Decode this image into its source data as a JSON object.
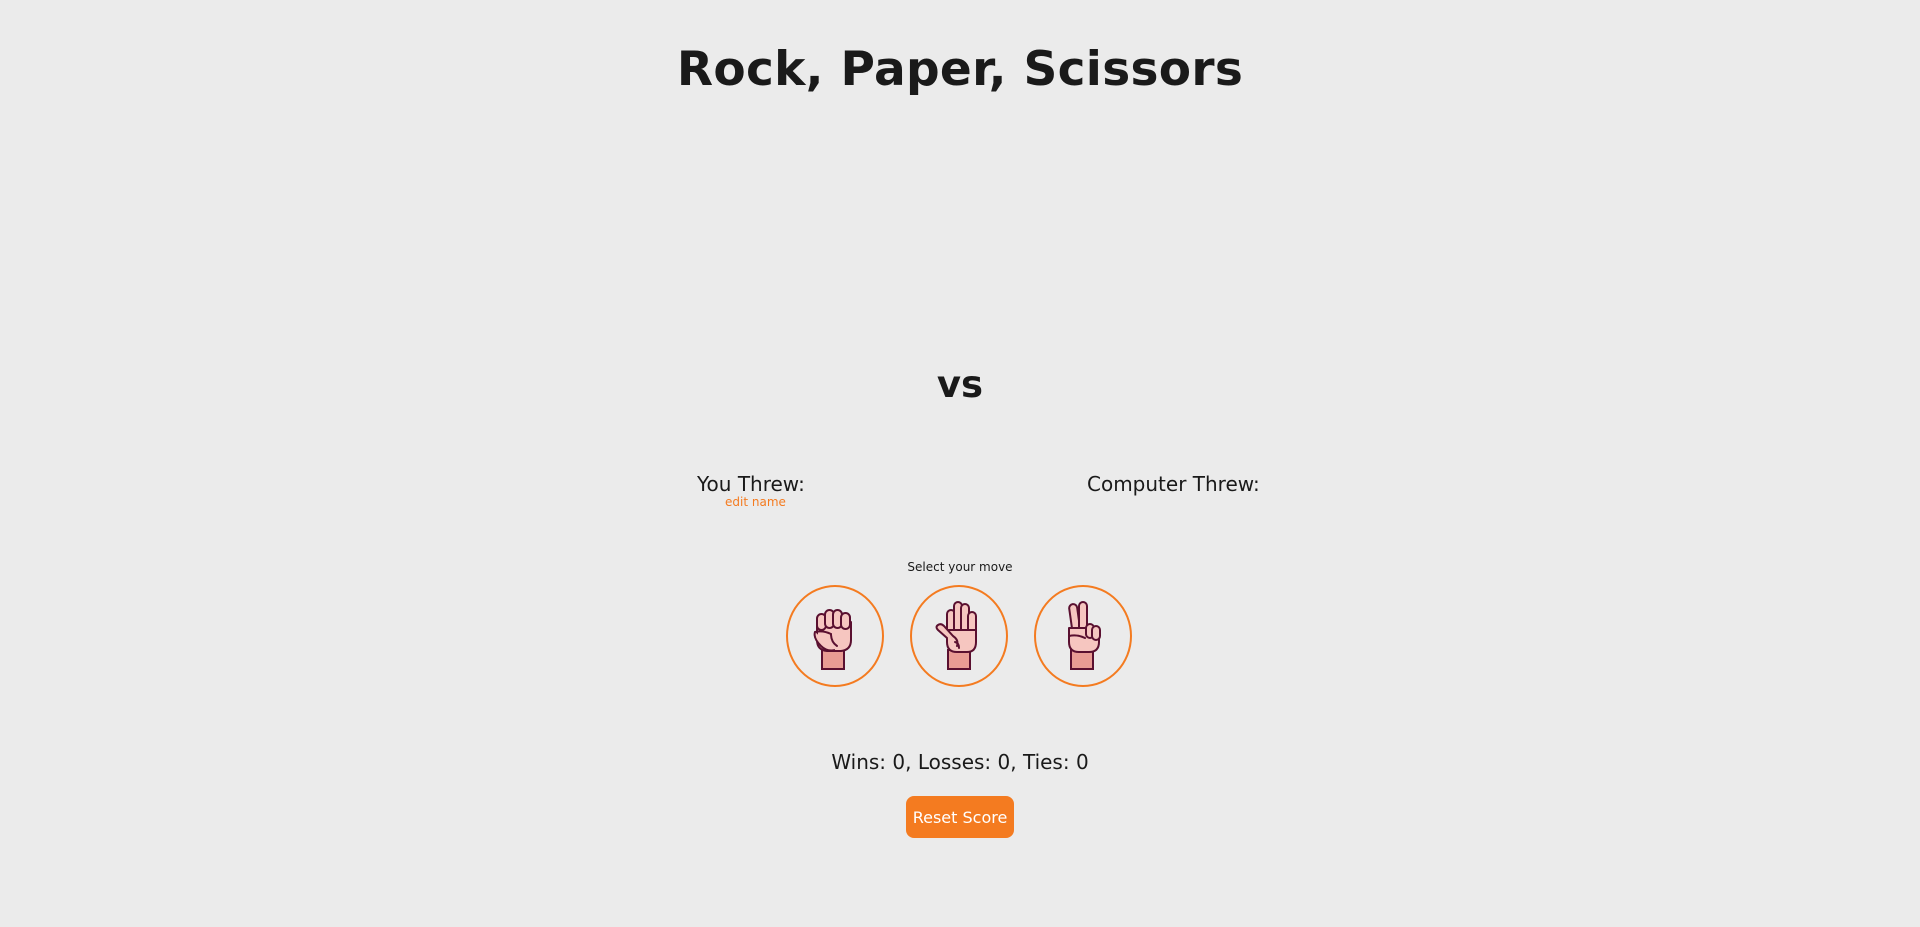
{
  "title": "Rock, Paper, Scissors",
  "vs_label": "vs",
  "player": {
    "threw_label": "You Threw:",
    "edit_name_label": "edit name"
  },
  "computer": {
    "threw_label": "Computer Threw:"
  },
  "moves": {
    "prompt": "Select your move",
    "options": [
      {
        "name": "rock",
        "icon": "fist-icon"
      },
      {
        "name": "paper",
        "icon": "open-hand-icon"
      },
      {
        "name": "scissors",
        "icon": "peace-hand-icon"
      }
    ]
  },
  "score": {
    "text": "Wins: 0, Losses: 0, Ties: 0"
  },
  "reset_button_label": "Reset Score",
  "colors": {
    "accent": "#f47b20",
    "background": "#ebebeb",
    "skin": "#f6c6c0",
    "skin_shadow": "#e99c94",
    "outline": "#5a1030"
  }
}
